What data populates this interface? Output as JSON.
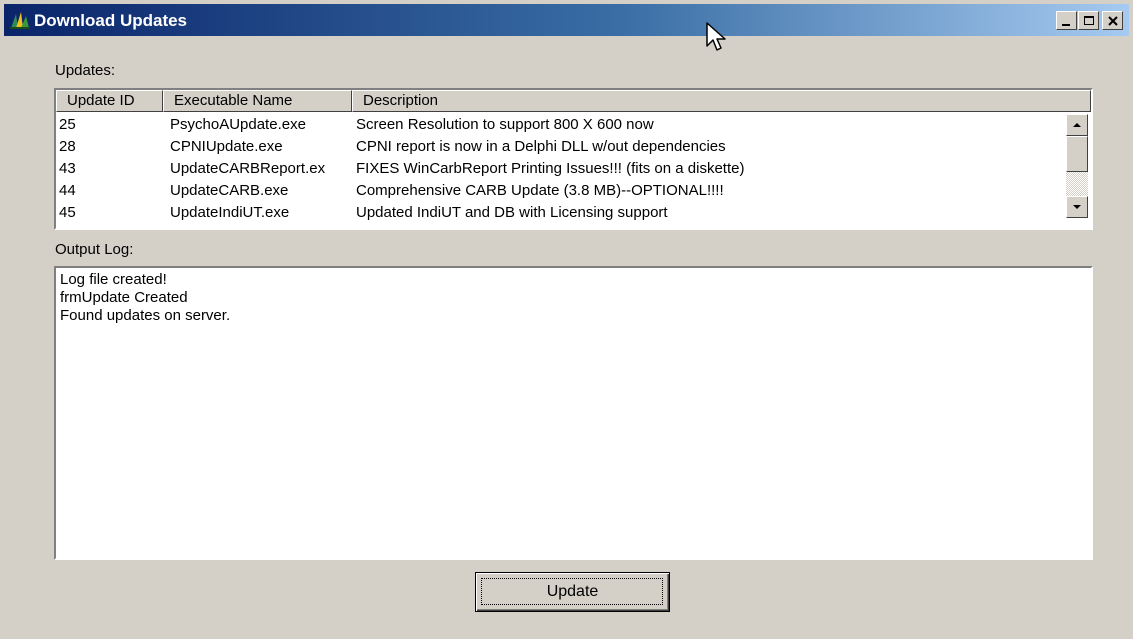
{
  "window": {
    "title": "Download Updates",
    "caption_buttons": [
      "minimize-icon",
      "maximize-icon",
      "close-icon"
    ],
    "colors": {
      "titlebar_start": "#0a246a",
      "titlebar_end": "#a6caf0",
      "face": "#d4d0c8"
    }
  },
  "updates": {
    "label": "Updates:",
    "columns": [
      "Update ID",
      "Executable Name",
      "Description"
    ],
    "rows": [
      {
        "id": "25",
        "exe": "PsychoAUpdate.exe",
        "desc": "Screen Resolution to support 800 X 600 now"
      },
      {
        "id": "28",
        "exe": "CPNIUpdate.exe",
        "desc": "CPNI report is now in a Delphi DLL w/out dependencies"
      },
      {
        "id": "43",
        "exe": "UpdateCARBReport.ex",
        "desc": "FIXES WinCarbReport Printing Issues!!! (fits on a diskette)"
      },
      {
        "id": "44",
        "exe": "UpdateCARB.exe",
        "desc": "Comprehensive CARB Update (3.8 MB)--OPTIONAL!!!!"
      },
      {
        "id": "45",
        "exe": "UpdateIndiUT.exe",
        "desc": "Updated IndiUT and DB with Licensing support"
      }
    ]
  },
  "output_log": {
    "label": "Output Log:",
    "lines": [
      "Log file created!",
      "frmUpdate Created",
      "Found updates on server."
    ]
  },
  "update_button": {
    "label": "Update"
  }
}
